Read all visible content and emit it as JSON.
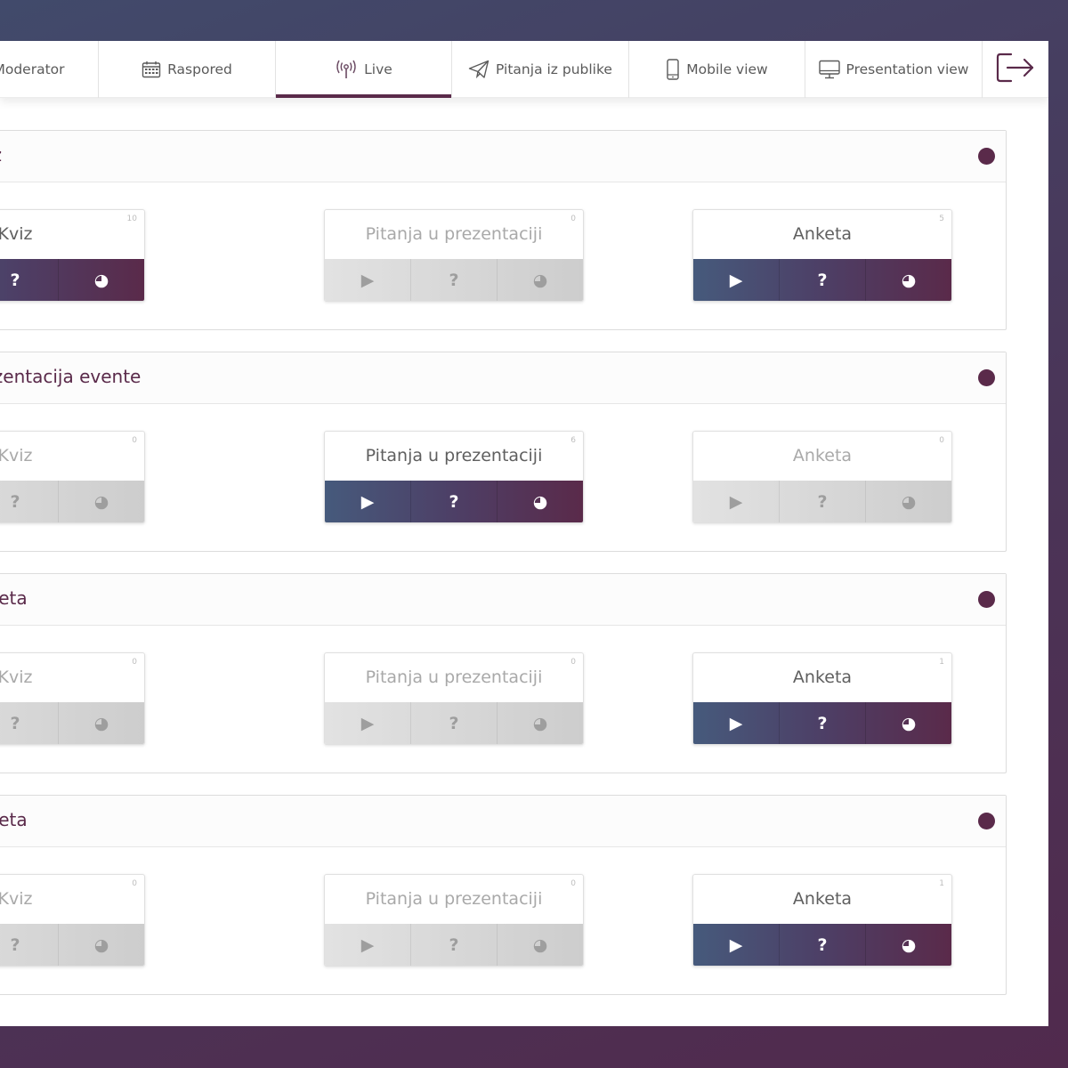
{
  "tabs": [
    {
      "label": "Moderator",
      "icon": "user-icon"
    },
    {
      "label": "Raspored",
      "icon": "calendar-icon"
    },
    {
      "label": "Live",
      "icon": "broadcast-icon",
      "active": true
    },
    {
      "label": "Pitanja iz publike",
      "icon": "send-icon"
    },
    {
      "label": "Mobile view",
      "icon": "mobile-icon"
    },
    {
      "label": "Presentation view",
      "icon": "monitor-icon"
    }
  ],
  "logout_icon": "logout-icon",
  "colors": {
    "accent": "#5a2a4a",
    "gradient_start": "#465a7c",
    "gradient_end": "#5a2a4a",
    "inactive": "#d5d5d5"
  },
  "sections": [
    {
      "title": "Kviz",
      "cards": [
        {
          "title": "Kviz",
          "count": "10",
          "active": true
        },
        {
          "title": "Pitanja u prezentaciji",
          "count": "0",
          "active": false
        },
        {
          "title": "Anketa",
          "count": "5",
          "active": true
        }
      ]
    },
    {
      "title": "Prezentacija evente",
      "cards": [
        {
          "title": "Kviz",
          "count": "0",
          "active": false
        },
        {
          "title": "Pitanja u prezentaciji",
          "count": "6",
          "active": true
        },
        {
          "title": "Anketa",
          "count": "0",
          "active": false
        }
      ]
    },
    {
      "title": "Anketa",
      "cards": [
        {
          "title": "Kviz",
          "count": "0",
          "active": false
        },
        {
          "title": "Pitanja u prezentaciji",
          "count": "0",
          "active": false
        },
        {
          "title": "Anketa",
          "count": "1",
          "active": true
        }
      ]
    },
    {
      "title": "Anketa",
      "cards": [
        {
          "title": "Kviz",
          "count": "0",
          "active": false
        },
        {
          "title": "Pitanja u prezentaciji",
          "count": "0",
          "active": false
        },
        {
          "title": "Anketa",
          "count": "1",
          "active": true
        }
      ]
    }
  ],
  "card_actions": {
    "play": "▶",
    "question": "?",
    "results": "◕"
  }
}
